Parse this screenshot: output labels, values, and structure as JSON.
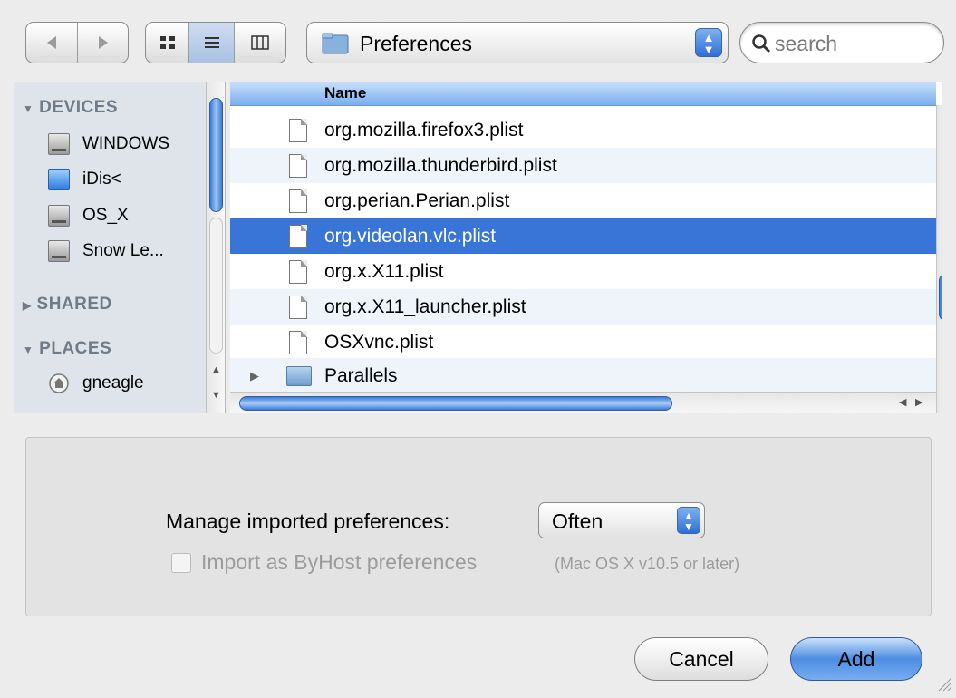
{
  "toolbar": {
    "back_icon": "back-arrow-icon",
    "forward_icon": "forward-arrow-icon",
    "view_modes": [
      "icon-view",
      "list-view",
      "column-view"
    ],
    "active_view": "list-view",
    "location": "Preferences",
    "search_placeholder": "search"
  },
  "sidebar": {
    "devices_header": "DEVICES",
    "devices": [
      {
        "label": "WINDOWS",
        "icon": "hard-disk-icon"
      },
      {
        "label": "iDis<",
        "icon": "idisk-icon"
      },
      {
        "label": "OS_X",
        "icon": "hard-disk-icon"
      },
      {
        "label": "Snow Le...",
        "icon": "hard-disk-icon"
      }
    ],
    "shared_header": "SHARED",
    "places_header": "PLACES",
    "places": [
      {
        "label": "gneagle",
        "icon": "home-icon"
      }
    ]
  },
  "file_list": {
    "column_name": "Name",
    "items": [
      {
        "name": "org.mozilla.firefox3.plist",
        "type": "file"
      },
      {
        "name": "org.mozilla.thunderbird.plist",
        "type": "file"
      },
      {
        "name": "org.perian.Perian.plist",
        "type": "file"
      },
      {
        "name": "org.videolan.vlc.plist",
        "type": "file",
        "selected": true
      },
      {
        "name": "org.x.X11.plist",
        "type": "file"
      },
      {
        "name": "org.x.X11_launcher.plist",
        "type": "file"
      },
      {
        "name": "OSXvnc.plist",
        "type": "file"
      },
      {
        "name": "Parallels",
        "type": "folder"
      }
    ]
  },
  "options": {
    "manage_label": "Manage imported preferences:",
    "manage_value": "Often",
    "byhost_label": "Import as ByHost preferences",
    "byhost_note": "(Mac OS X v10.5 or later)",
    "byhost_checked": false
  },
  "buttons": {
    "cancel": "Cancel",
    "add": "Add"
  },
  "colors": {
    "selection": "#3875d7",
    "accent": "#4d8ce2"
  }
}
